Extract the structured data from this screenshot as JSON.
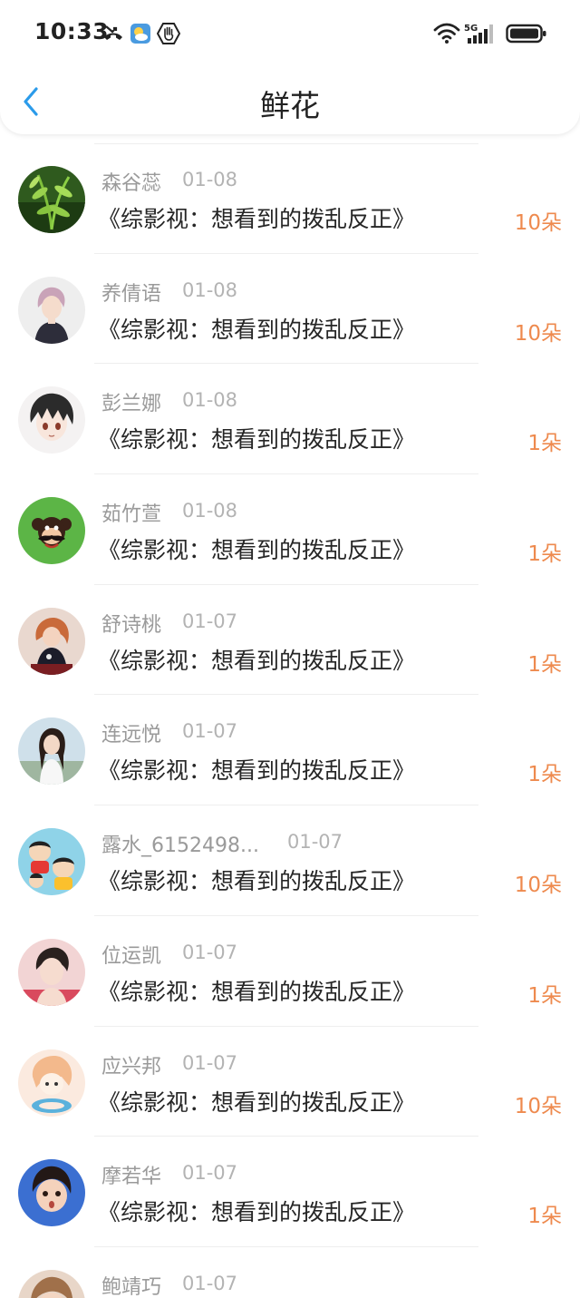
{
  "status_bar": {
    "time": "10:33",
    "icons": [
      "missed-call-icon",
      "weather-icon",
      "hand-icon",
      "wifi-icon",
      "5g-signal-icon",
      "battery-icon"
    ],
    "network_label": "5G"
  },
  "nav": {
    "title": "鲜花",
    "back_icon": "chevron-left-icon"
  },
  "colors": {
    "accent_blue": "#2b9bea",
    "count_orange": "#ee8a4e",
    "name_gray": "#9a9a9a",
    "date_gray": "#b3b3b3",
    "text_dark": "#262626"
  },
  "items": [
    {
      "name": "森谷蕊",
      "date": "01-08",
      "book": "《综影视：想看到的拨乱反正》",
      "count": "10朵"
    },
    {
      "name": "养倩语",
      "date": "01-08",
      "book": "《综影视：想看到的拨乱反正》",
      "count": "10朵"
    },
    {
      "name": "彭兰娜",
      "date": "01-08",
      "book": "《综影视：想看到的拨乱反正》",
      "count": "1朵"
    },
    {
      "name": "茹竹萱",
      "date": "01-08",
      "book": "《综影视：想看到的拨乱反正》",
      "count": "1朵"
    },
    {
      "name": "舒诗桃",
      "date": "01-07",
      "book": "《综影视：想看到的拨乱反正》",
      "count": "1朵"
    },
    {
      "name": "连远悦",
      "date": "01-07",
      "book": "《综影视：想看到的拨乱反正》",
      "count": "1朵"
    },
    {
      "name": "露水_6152498...",
      "date": "01-07",
      "book": "《综影视：想看到的拨乱反正》",
      "count": "10朵"
    },
    {
      "name": "位运凯",
      "date": "01-07",
      "book": "《综影视：想看到的拨乱反正》",
      "count": "1朵"
    },
    {
      "name": "应兴邦",
      "date": "01-07",
      "book": "《综影视：想看到的拨乱反正》",
      "count": "10朵"
    },
    {
      "name": "摩若华",
      "date": "01-07",
      "book": "《综影视：想看到的拨乱反正》",
      "count": "1朵"
    },
    {
      "name": "鲍靖巧",
      "date": "01-07",
      "book": "",
      "count": ""
    }
  ]
}
